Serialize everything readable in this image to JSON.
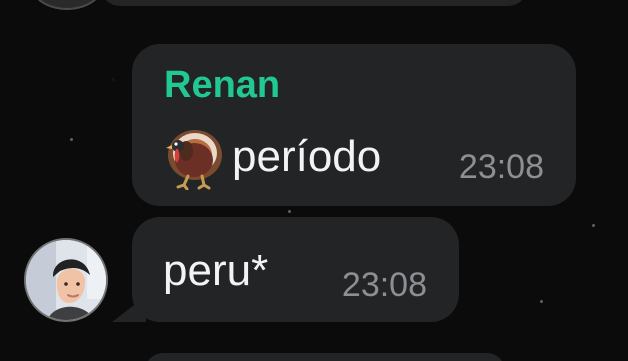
{
  "conversation": {
    "messages": [
      {
        "sender": "Renan",
        "emoji": "turkey-emoji",
        "text": "período",
        "time": "23:08"
      },
      {
        "text": "peru*",
        "time": "23:08"
      }
    ]
  },
  "colors": {
    "background": "#0b0b0b",
    "bubble": "#232426",
    "sender": "#21c891",
    "message_text": "#f3f3f3",
    "timestamp": "#8e8f93"
  },
  "icons": {
    "message_emoji": "turkey-emoji",
    "contact_avatar": "avatar"
  }
}
